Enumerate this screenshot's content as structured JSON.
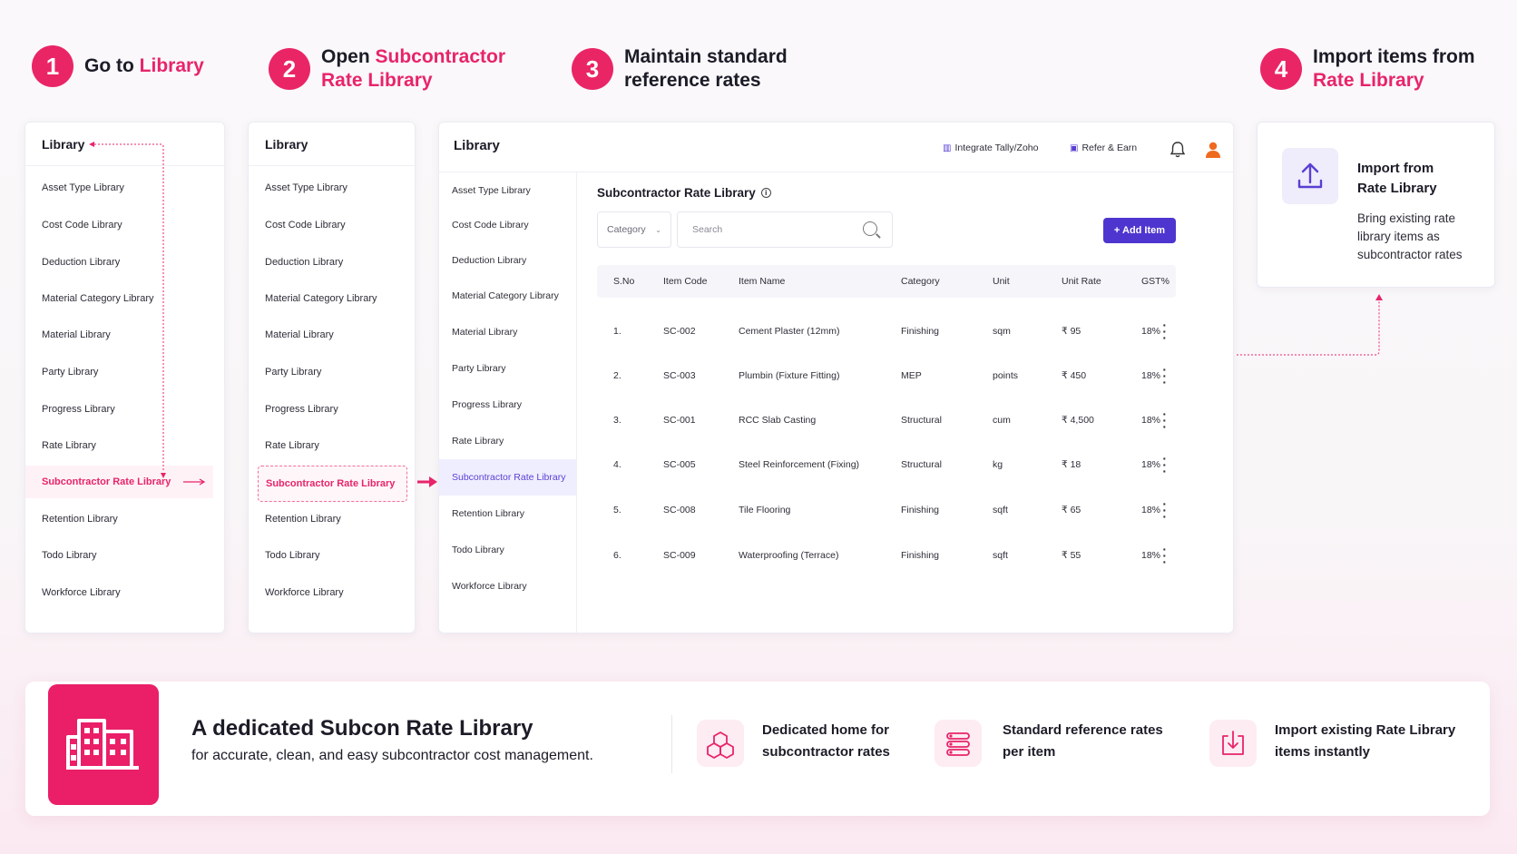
{
  "steps": [
    {
      "num": "1",
      "text_plain": "Go to ",
      "text_accent": "Library"
    },
    {
      "num": "2",
      "text_plain": "Open ",
      "text_accent": "Subcontractor Rate Library"
    },
    {
      "num": "3",
      "text_plain": "Maintain standard reference rates",
      "text_accent": ""
    },
    {
      "num": "4",
      "text_plain": "Import items from ",
      "text_accent": "Rate Library"
    }
  ],
  "library": {
    "title": "Library",
    "items": [
      "Asset Type Library",
      "Cost Code Library",
      "Deduction Library",
      "Material Category Library",
      "Material Library",
      "Party Library",
      "Progress Library",
      "Rate Library",
      "Subcontractor Rate Library",
      "Retention Library",
      "Todo Library",
      "Workforce Library"
    ]
  },
  "app": {
    "title": "Library",
    "integrate_label": "Integrate Tally/Zoho",
    "refer_label": "Refer & Earn",
    "page_title": "Subcontractor Rate Library",
    "category_placeholder": "Category",
    "search_placeholder": "Search",
    "add_button": "+ Add Item",
    "columns": [
      "S.No",
      "Item Code",
      "Item Name",
      "Category",
      "Unit",
      "Unit Rate",
      "GST%"
    ],
    "rows": [
      [
        "1.",
        "SC-002",
        "Cement Plaster (12mm)",
        "Finishing",
        "sqm",
        "₹ 95",
        "18%"
      ],
      [
        "2.",
        "SC-003",
        "Plumbin (Fixture Fitting)",
        "MEP",
        "points",
        "₹ 450",
        "18%"
      ],
      [
        "3.",
        "SC-001",
        "RCC Slab Casting",
        "Structural",
        "cum",
        "₹ 4,500",
        "18%"
      ],
      [
        "4.",
        "SC-005",
        "Steel Reinforcement (Fixing)",
        "Structural",
        "kg",
        "₹ 18",
        "18%"
      ],
      [
        "5.",
        "SC-008",
        "Tile Flooring",
        "Finishing",
        "sqft",
        "₹ 65",
        "18%"
      ],
      [
        "6.",
        "SC-009",
        "Waterproofing (Terrace)",
        "Finishing",
        "sqft",
        "₹ 55",
        "18%"
      ]
    ]
  },
  "import_card": {
    "title_line1": "Import from",
    "title_line2": "Rate Library",
    "desc_lines": [
      "Bring existing rate",
      "library items as",
      "subcontractor rates"
    ]
  },
  "banner": {
    "title": "A dedicated Subcon Rate Library",
    "subtitle": "for accurate, clean, and easy subcontractor cost management.",
    "features": [
      {
        "icon": "cube-icon",
        "line1": "Dedicated home for",
        "line2": "subcontractor rates"
      },
      {
        "icon": "list-icon",
        "line1": "Standard reference rates",
        "line2": "per item"
      },
      {
        "icon": "import-icon",
        "line1": "Import existing Rate Library",
        "line2": "items instantly"
      }
    ]
  },
  "colors": {
    "accent_pink": "#e8246a",
    "accent_purple": "#4f35cf"
  }
}
